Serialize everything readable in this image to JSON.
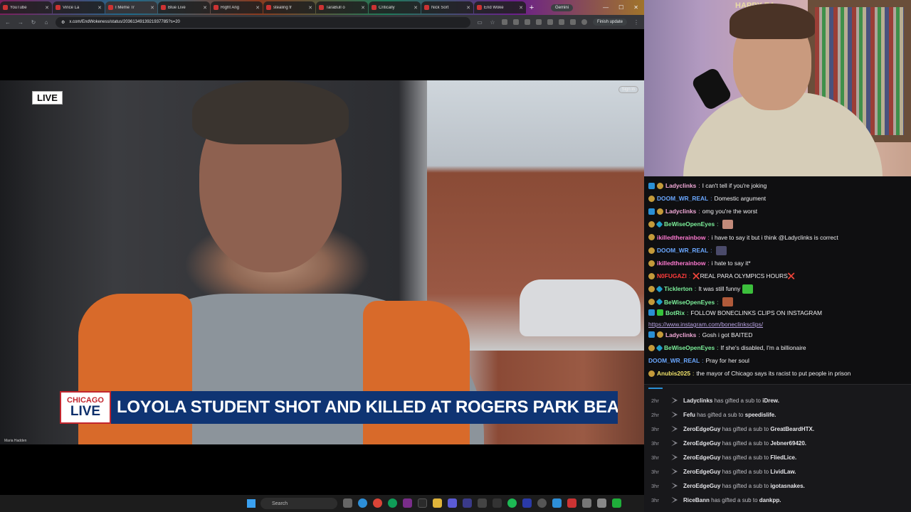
{
  "browser": {
    "tabs": [
      {
        "label": "YouTube",
        "active": false
      },
      {
        "label": "Vince La",
        "active": false
      },
      {
        "label": "I Meme Tr",
        "active": true
      },
      {
        "label": "Blue Live",
        "active": false
      },
      {
        "label": "Right Ang",
        "active": false
      },
      {
        "label": "stealing fr",
        "active": false
      },
      {
        "label": "TaraBull o",
        "active": false
      },
      {
        "label": "Critically",
        "active": false
      },
      {
        "label": "Nick Sort",
        "active": false
      },
      {
        "label": "End Woke",
        "active": false
      }
    ],
    "new_tab": "+",
    "gemini_label": "Gemini",
    "url": "x.com/EndWokeness/status/2036134913921937785?s=20",
    "finish_update": "Finish update"
  },
  "video": {
    "live_badge": "LIVE",
    "sign_in": "Sign in",
    "logo_top": "CHICAGO",
    "logo_bottom": "LIVE",
    "headline": "LOYOLA STUDENT SHOT AND KILLED AT ROGERS PARK BEACH",
    "credit": "Maria Hadden"
  },
  "taskbar": {
    "search_label": "Search"
  },
  "webcam": {
    "banner_text": "HAPPY EA"
  },
  "chat": {
    "messages": [
      {
        "user": "Ladyclinks",
        "color": "#f2a9d8",
        "badges": [
          "vip",
          "sub"
        ],
        "text": "I can't tell if you're joking"
      },
      {
        "user": "DOOM_WR_REAL",
        "color": "#6aa7ff",
        "badges": [
          "sub"
        ],
        "text": "Domestic argument"
      },
      {
        "user": "Ladyclinks",
        "color": "#f2a9d8",
        "badges": [
          "vip",
          "sub"
        ],
        "text": "omg you're the worst"
      },
      {
        "user": "BeWiseOpenEyes",
        "color": "#7cf09a",
        "badges": [
          "sub",
          "gem"
        ],
        "text": "",
        "emote": "#c28a7a"
      },
      {
        "user": "ikilledtherainbow",
        "color": "#ff7ad1",
        "badges": [
          "sub"
        ],
        "text": "i have to say it but i think @Ladyclinks is correct"
      },
      {
        "user": "DOOM_WR_REAL",
        "color": "#6aa7ff",
        "badges": [
          "sub"
        ],
        "text": "",
        "emote": "#4a4a6a"
      },
      {
        "user": "ikilledtherainbow",
        "color": "#ff7ad1",
        "badges": [
          "sub"
        ],
        "text": "i hate to say it*"
      },
      {
        "user": "N0FUGAZI",
        "color": "#ff3b3b",
        "badges": [
          "sub"
        ],
        "text": "❌REAL PARA OLYMPICS HOURS❌"
      },
      {
        "user": "Ticklerton",
        "color": "#7cf09a",
        "badges": [
          "sub",
          "gem"
        ],
        "text": "It was still funny",
        "emote": "#3cbf3c"
      },
      {
        "user": "BeWiseOpenEyes",
        "color": "#7cf09a",
        "badges": [
          "sub",
          "gem"
        ],
        "text": "",
        "emote": "#b05a3a"
      },
      {
        "user": "BotRix",
        "color": "#7cf09a",
        "badges": [
          "vip",
          "mod"
        ],
        "text": "FOLLOW BONECLINKS CLIPS ON INSTAGRAM",
        "link": "https://www.instagram.com/boneclinksclips/"
      },
      {
        "user": "Ladyclinks",
        "color": "#f2a9d8",
        "badges": [
          "vip",
          "sub"
        ],
        "text": "Gosh i got BAITED"
      },
      {
        "user": "BeWiseOpenEyes",
        "color": "#7cf09a",
        "badges": [
          "sub",
          "gem"
        ],
        "text": "If she's disabled, I'm a billionaire"
      },
      {
        "user": "DOOM_WR_REAL",
        "color": "#6aa7ff",
        "badges": [],
        "text": "Pray for her soul"
      },
      {
        "user": "Anubis2025",
        "color": "#f0e26a",
        "badges": [
          "sub"
        ],
        "text": "the mayor of Chicago says its racist to put people in prison"
      }
    ]
  },
  "events": [
    {
      "time": "2hr",
      "gifter": "Ladyclinks",
      "mid": "has gifted a sub to",
      "recipient": "iDrew."
    },
    {
      "time": "2hr",
      "gifter": "Fefu",
      "mid": "has gifted a sub to",
      "recipient": "speedislife."
    },
    {
      "time": "3hr",
      "gifter": "ZeroEdgeGuy",
      "mid": "has gifted a sub to",
      "recipient": "GreatBeardHTX."
    },
    {
      "time": "3hr",
      "gifter": "ZeroEdgeGuy",
      "mid": "has gifted a sub to",
      "recipient": "Jebner69420."
    },
    {
      "time": "3hr",
      "gifter": "ZeroEdgeGuy",
      "mid": "has gifted a sub to",
      "recipient": "FliedLice."
    },
    {
      "time": "3hr",
      "gifter": "ZeroEdgeGuy",
      "mid": "has gifted a sub to",
      "recipient": "LividLaw."
    },
    {
      "time": "3hr",
      "gifter": "ZeroEdgeGuy",
      "mid": "has gifted a sub to",
      "recipient": "igotasnakes."
    },
    {
      "time": "3hr",
      "gifter": "RiceBann",
      "mid": "has gifted a sub to",
      "recipient": "dankpp."
    }
  ]
}
